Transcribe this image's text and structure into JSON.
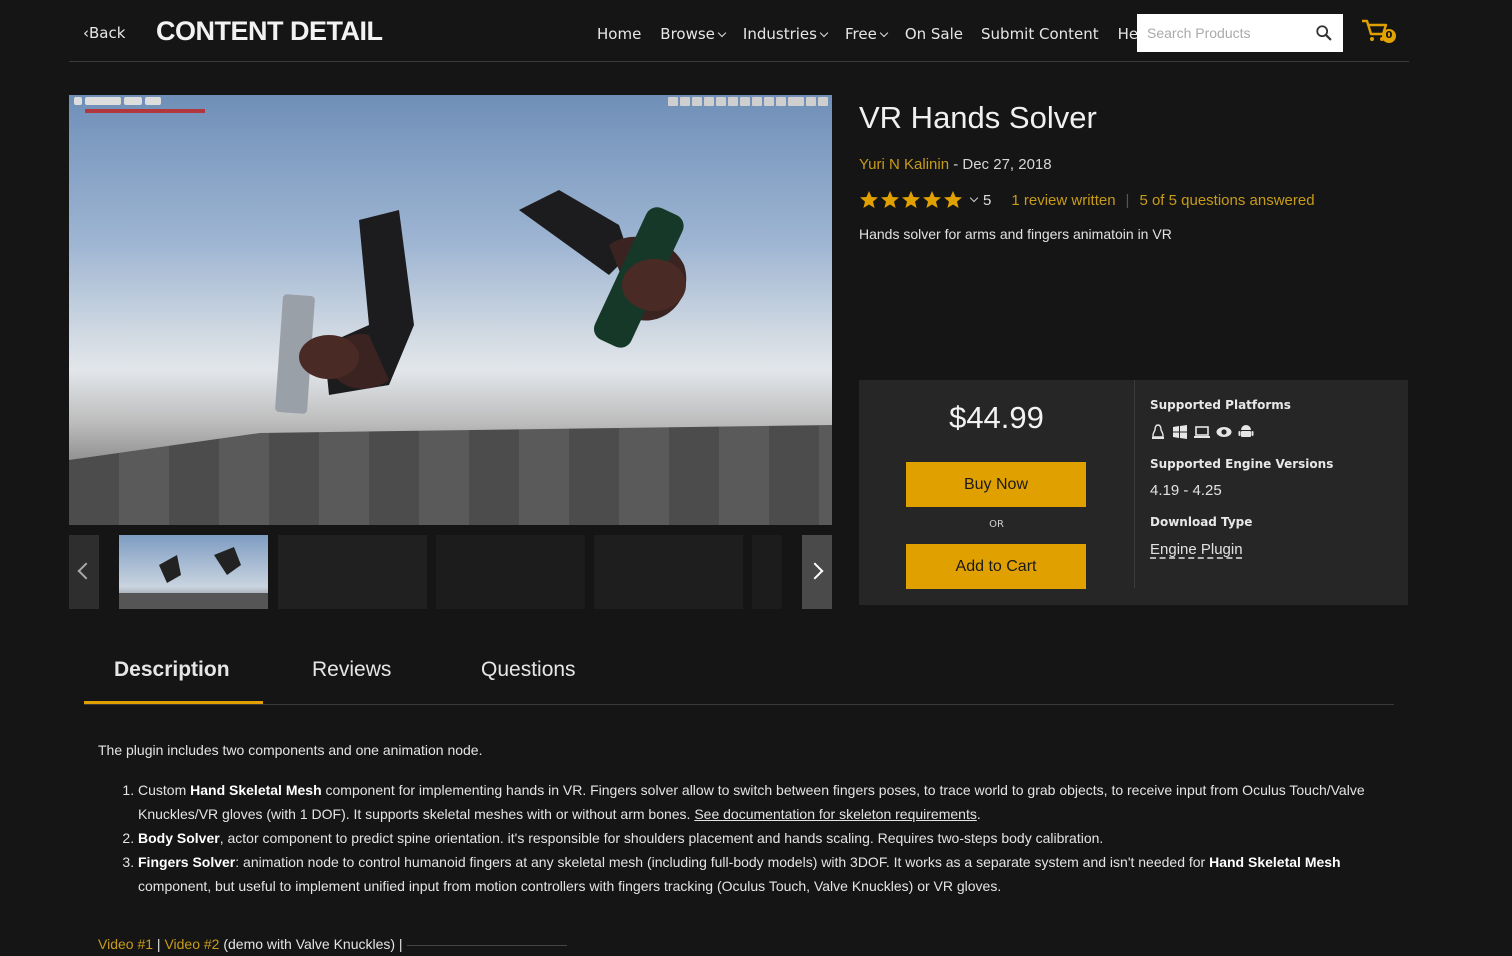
{
  "header": {
    "back_label": "Back",
    "page_title": "CONTENT DETAIL",
    "nav": [
      {
        "label": "Home",
        "has_dropdown": false
      },
      {
        "label": "Browse",
        "has_dropdown": true
      },
      {
        "label": "Industries",
        "has_dropdown": true
      },
      {
        "label": "Free",
        "has_dropdown": true
      },
      {
        "label": "On Sale",
        "has_dropdown": false
      },
      {
        "label": "Submit Content",
        "has_dropdown": false
      },
      {
        "label": "Help",
        "has_dropdown": false
      }
    ],
    "search_placeholder": "Search Products",
    "cart_count": "0"
  },
  "product": {
    "title": "VR Hands Solver",
    "author": "Yuri N Kalinin",
    "date": "- Dec 27, 2018",
    "rating_stars": 5,
    "rating_count": "5",
    "reviews_link": "1 review written",
    "questions_link": "5 of 5 questions answered",
    "tagline": "Hands solver for arms and fingers animatoin in VR"
  },
  "purchase": {
    "price": "$44.99",
    "buy_now": "Buy Now",
    "or": "OR",
    "add_to_cart": "Add to Cart",
    "platforms_label": "Supported Platforms",
    "platforms": [
      "linux-icon",
      "windows-icon",
      "mac-icon",
      "vr-icon",
      "android-icon"
    ],
    "engine_label": "Supported Engine Versions",
    "engine_versions": "4.19 - 4.25",
    "download_label": "Download Type",
    "download_type": "Engine Plugin"
  },
  "tabs": [
    "Description",
    "Reviews",
    "Questions"
  ],
  "description": {
    "intro": "The plugin includes two components and one animation node.",
    "item1_pre": "Custom ",
    "item1_bold": "Hand Skeletal Mesh",
    "item1_rest": " component for implementing hands in VR. Fingers solver allow to switch between fingers poses, to trace world to grab objects, to receive input from Oculus Touch/Valve Knuckles/VR gloves (with 1 DOF). It supports skeletal meshes with or without arm bones. ",
    "item1_link": "See documentation for skeleton requirements",
    "item1_end": ".",
    "item2_bold": "Body Solver",
    "item2_rest": ", actor component to predict spine orientation. it's responsible for shoulders placement and hands scaling. Requires two-steps body calibration.",
    "item3_bold": "Fingers Solver",
    "item3_rest": ": animation node to control humanoid fingers at any skeletal mesh (including full-body models) with 3DOF. It works as a separate system and isn't needed for ",
    "item3_bold2": "Hand Skeletal Mesh",
    "item3_end": " component, but useful to implement unified input from motion controllers with fingers tracking (Oculus Touch, Valve Knuckles) or VR gloves."
  },
  "videos": {
    "video1": "Video #1",
    "sep1": " | ",
    "video2": "Video #2",
    "video2_note": " (demo with Valve Knuckles) |"
  },
  "colors": {
    "accent": "#e0a100",
    "link_gold": "#c79b1a",
    "background": "#151515",
    "panel": "#262626"
  }
}
